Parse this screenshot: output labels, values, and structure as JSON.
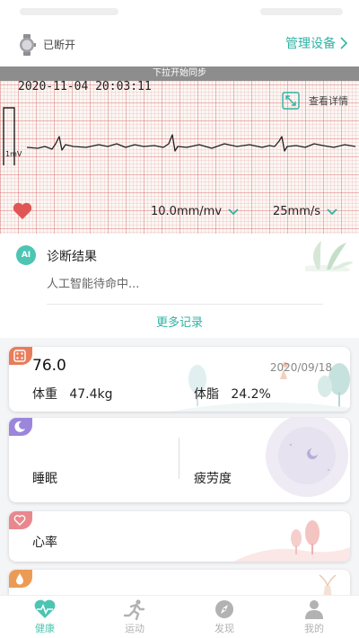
{
  "device": {
    "status": "已断开",
    "manage_label": "管理设备",
    "icon": "smartwatch-icon"
  },
  "ecg": {
    "sync_banner": "下拉开始同步",
    "timestamp": "2020-11-04 20:03:11",
    "detail_label": "查看详情",
    "calibration_label": "1mV",
    "gain": "10.0mm/mv",
    "speed": "25mm/s"
  },
  "diagnosis": {
    "badge": "AI",
    "title": "诊断结果",
    "text": "人工智能待命中...",
    "more_label": "更多记录"
  },
  "weight_card": {
    "value": "76.0",
    "date": "2020/09/18",
    "weight_label": "体重",
    "weight_value": "47.4kg",
    "fat_label": "体脂",
    "fat_value": "24.2%",
    "badge_color": "#e97c5a"
  },
  "sleep_card": {
    "sleep_label": "睡眠",
    "fatigue_label": "疲劳度",
    "badge_color": "#9b86dc"
  },
  "heart_rate_card": {
    "label": "心率",
    "badge_color": "#e8888e"
  },
  "partial_card": {
    "badge_color": "#ec9b55"
  },
  "tabs": [
    {
      "label": "健康",
      "icon": "heart-pulse-icon",
      "active": true
    },
    {
      "label": "运动",
      "icon": "running-icon",
      "active": false
    },
    {
      "label": "发现",
      "icon": "compass-icon",
      "active": false
    },
    {
      "label": "我的",
      "icon": "person-icon",
      "active": false
    }
  ],
  "colors": {
    "accent": "#2fb3a4",
    "tab_active": "#4cc5b3",
    "heart": "#e05656"
  }
}
